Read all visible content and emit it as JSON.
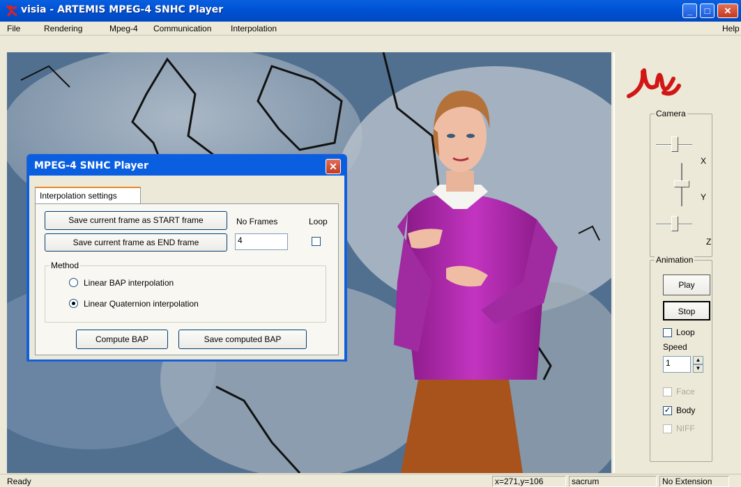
{
  "window": {
    "title": "visia - ARTEMIS MPEG-4 SNHC Player"
  },
  "menu": {
    "file": "File",
    "rendering": "Rendering",
    "mpeg4": "Mpeg-4",
    "communication": "Communication",
    "interpolation": "Interpolation",
    "help": "Help"
  },
  "dialog": {
    "title": "MPEG-4 SNHC Player",
    "tab": "Interpolation settings",
    "save_start": "Save current frame as START frame",
    "save_end": "Save current frame as END frame",
    "no_frames_label": "No Frames",
    "no_frames_value": "4",
    "loop_label": "Loop",
    "method_label": "Method",
    "method_linear_bap": "Linear BAP interpolation",
    "method_linear_quat": "Linear Quaternion interpolation",
    "compute": "Compute BAP",
    "save_computed": "Save computed BAP"
  },
  "panel": {
    "camera_label": "Camera",
    "x_label": "X",
    "y_label": "Y",
    "z_label": "Z",
    "animation_label": "Animation",
    "play": "Play",
    "stop": "Stop",
    "loop": "Loop",
    "speed": "Speed",
    "speed_value": "1",
    "face": "Face",
    "body": "Body",
    "niff": "NIFF"
  },
  "status": {
    "ready": "Ready",
    "coords": "x=271,y=106",
    "segment": "sacrum",
    "extension": "No Extension"
  },
  "colors": {
    "titlebar": "#0053d6",
    "sweater": "#b126b0",
    "skirt": "#a8521c",
    "logo": "#d11616"
  }
}
